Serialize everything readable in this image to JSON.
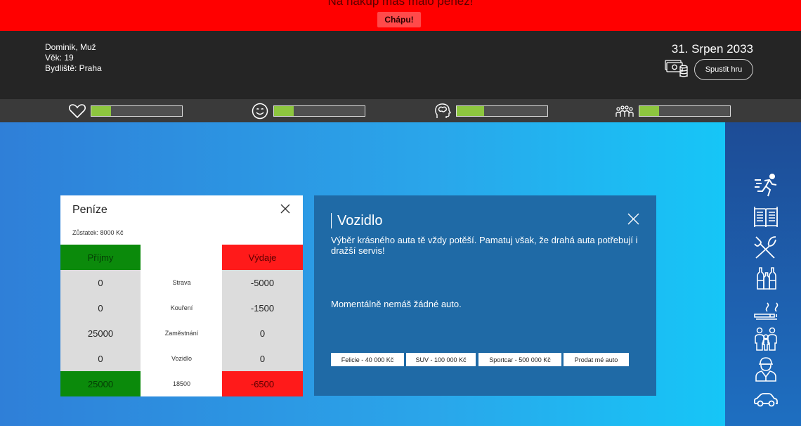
{
  "alert": {
    "message": "Na nákup máš málo peněz!",
    "button": "Chápu!"
  },
  "player": {
    "name_gender": "Dominik, Muž",
    "age": "Věk: 19",
    "residence": "Bydliště: Praha"
  },
  "date": "31. Srpen 2033",
  "header": {
    "start_button": "Spustit hru",
    "money_icon": "money-icon"
  },
  "stats": [
    {
      "name": "health",
      "icon": "heart-icon",
      "level": 0.22
    },
    {
      "name": "happiness",
      "icon": "smile-icon",
      "level": 0.22
    },
    {
      "name": "intelligence",
      "icon": "brain-head-icon",
      "level": 0.3
    },
    {
      "name": "social",
      "icon": "people-icon",
      "level": 0.22
    }
  ],
  "sidebar": {
    "icons": [
      "running-icon",
      "book-icon",
      "cutlery-icon",
      "bottles-icon",
      "smoking-icon",
      "family-icon",
      "worker-icon",
      "car-icon"
    ]
  },
  "money": {
    "title": "Peníze",
    "balance": "Zůstatek: 8000 Kč",
    "income_header": "Příjmy",
    "expense_header": "Výdaje",
    "rows": [
      {
        "income": "0",
        "label": "Strava",
        "expense": "-5000"
      },
      {
        "income": "0",
        "label": "Kouření",
        "expense": "-1500"
      },
      {
        "income": "25000",
        "label": "Zaměstnání",
        "expense": "0"
      },
      {
        "income": "0",
        "label": "Vozidlo",
        "expense": "0"
      }
    ],
    "total_income": "25000",
    "total": "18500",
    "total_expense": "-6500"
  },
  "vehicle": {
    "title": "Vozidlo",
    "description": "Výběr krásného auta tě vždy potěší. Pamatuj však, že drahá auta potřebují i dražší servis!",
    "status": "Momentálně nemáš žádné auto.",
    "buttons": [
      "Felicie - 40 000 Kč",
      "SUV - 100 000 Kč",
      "Sportcar - 500 000 Kč",
      "Prodat mé auto"
    ]
  },
  "colors": {
    "alert": "#ff0000",
    "header": "#252525",
    "stat_fill": "#8dc63f",
    "income": "#0b8a0b",
    "expense": "#ff1a1a"
  }
}
